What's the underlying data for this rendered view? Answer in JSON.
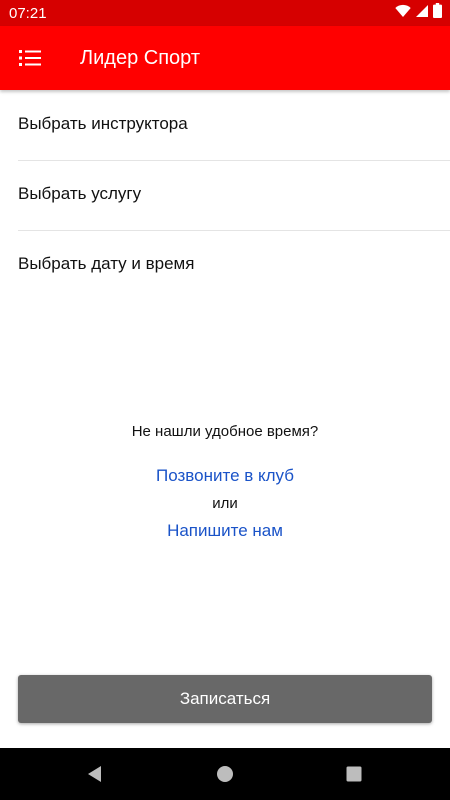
{
  "status_bar": {
    "time": "07:21",
    "icons": [
      "wifi-icon",
      "signal-icon",
      "battery-icon"
    ]
  },
  "app_bar": {
    "title": "Лидер Спорт",
    "menu_icon": "menu-list-icon"
  },
  "options": [
    {
      "label": "Выбрать инструктора"
    },
    {
      "label": "Выбрать услугу"
    },
    {
      "label": "Выбрать дату и время"
    }
  ],
  "help": {
    "question": "Не нашли удобное время?",
    "call_link": "Позвоните в клуб",
    "or_text": "или",
    "write_link": "Напишите нам"
  },
  "book_button": {
    "label": "Записаться"
  },
  "nav_bar": {
    "icons": [
      "back-icon",
      "home-icon",
      "recents-icon"
    ]
  },
  "colors": {
    "status_bar": "#d60000",
    "app_bar": "#ff0000",
    "link": "#1a53c8",
    "button": "#686868"
  }
}
